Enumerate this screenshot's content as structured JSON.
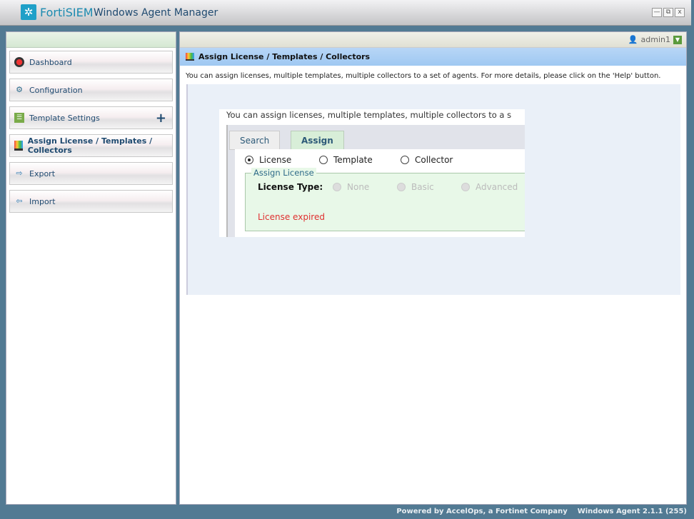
{
  "window": {
    "brand": "FortiSIEM",
    "title": "Windows Agent Manager",
    "buttons": [
      "—",
      "⧉",
      "x"
    ]
  },
  "sidebar": {
    "items": [
      {
        "label": "Dashboard",
        "icon": "dashboard-icon"
      },
      {
        "label": "Configuration",
        "icon": "gear-icon"
      },
      {
        "label": "Template Settings",
        "icon": "list-icon"
      },
      {
        "label": "Assign License / Templates / Collectors",
        "icon": "monitor-icon"
      },
      {
        "label": "Export",
        "icon": "export-icon"
      },
      {
        "label": "Import",
        "icon": "import-icon"
      }
    ]
  },
  "user": {
    "name": "admin1"
  },
  "main": {
    "title": "Assign License / Templates / Collectors",
    "description": "You can assign licenses, multiple templates, multiple collectors to a set of agents. For more details, please click on the 'Help' button.",
    "screenshot": {
      "text": "You can assign licenses, multiple templates, multiple collectors to a s",
      "tabs": [
        "Search",
        "Assign"
      ],
      "modes": [
        "License",
        "Template",
        "Collector"
      ],
      "legend": "Assign License",
      "license_type_label": "License Type:",
      "license_options": [
        "None",
        "Basic",
        "Advanced"
      ],
      "status": "License expired"
    }
  },
  "footer": {
    "powered": "Powered by AccelOps, a Fortinet Company",
    "version": "Windows Agent 2.1.1 (255)"
  },
  "colors": {
    "accent": "#1f4a70",
    "error": "#e03030",
    "background": "#527a93"
  }
}
